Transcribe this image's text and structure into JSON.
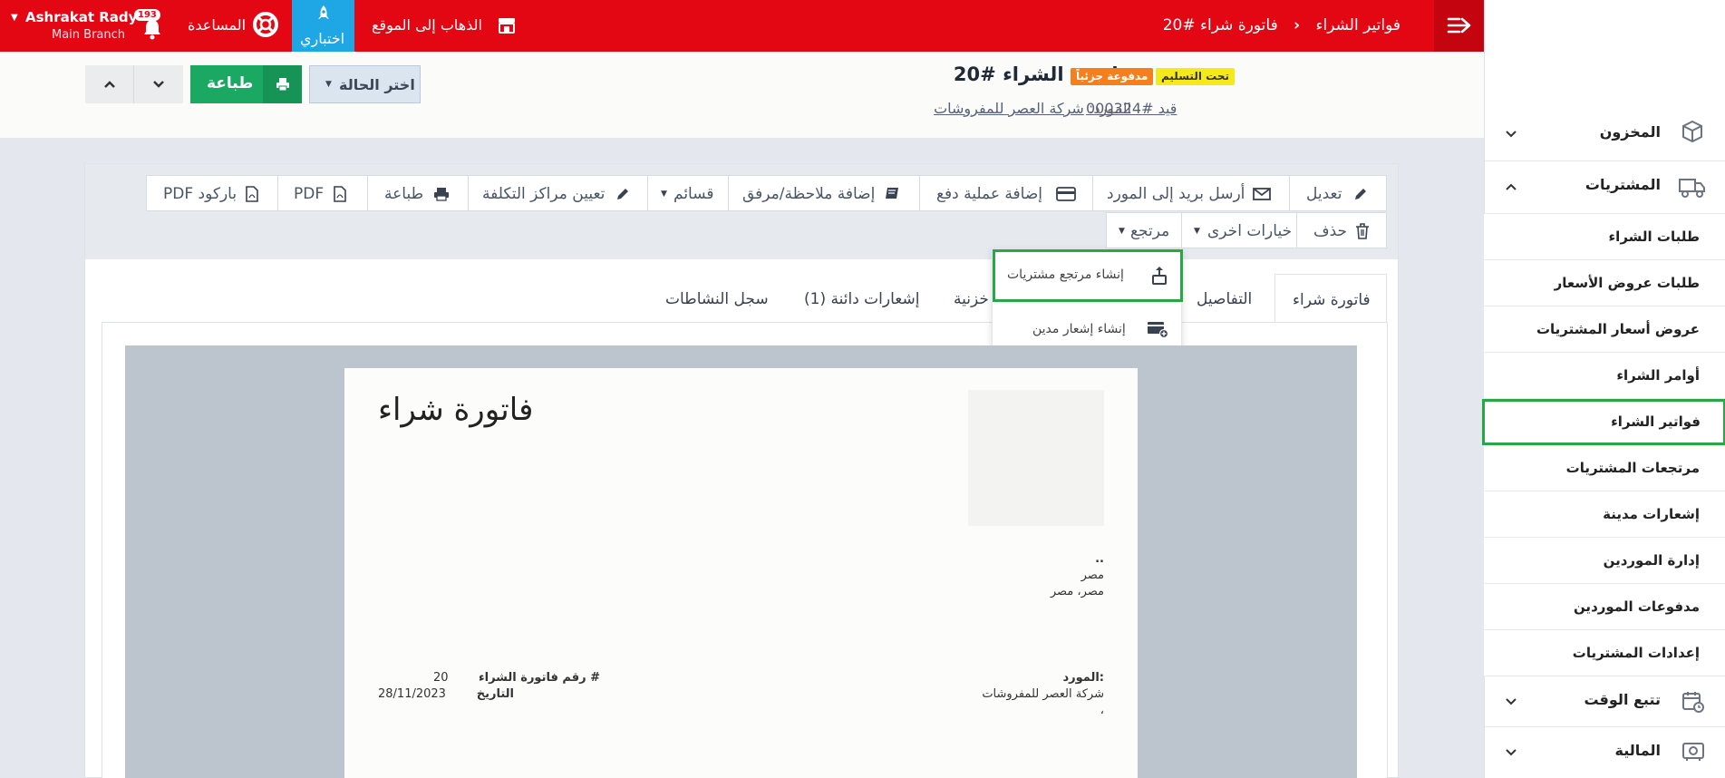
{
  "topbar": {
    "breadcrumb_parent": "فواتير الشراء",
    "breadcrumb_current": "فاتورة شراء #20",
    "goto_site": "الذهاب إلى الموقع",
    "trial": "اختباري",
    "help": "المساعدة",
    "notification_count": "193",
    "user_name": "Ashrakat Rady",
    "branch": "Main Branch"
  },
  "header": {
    "title": "فاتورة الشراء #20",
    "badge_delivery": "تحت التسليم",
    "badge_payment": "مدفوعة جزئياً",
    "supplier_label": "المورد:",
    "supplier_name": "شركة العصر للمفروشات",
    "journal_link": "قيد #000324",
    "status_select": "اختر الحالة",
    "print_button": "طباعة"
  },
  "toolbar": {
    "row1": [
      "تعديل",
      "أرسل بريد إلى المورد",
      "إضافة عملية دفع",
      "إضافة ملاحظة/مرفق",
      "قسائم",
      "تعيين مراكز التكلفة",
      "طباعة",
      "PDF",
      "PDF باركود"
    ],
    "row2": [
      "حذف",
      "خيارات اخرى",
      "مرتجع"
    ]
  },
  "dropdown": {
    "items": [
      "إنشاء مرتجع مشتريات",
      "إنشاء إشعار مدين"
    ]
  },
  "tabs": [
    "فاتورة شراء",
    "التفاصيل",
    "خزنية",
    "إشعارات دائنة (1)",
    "سجل النشاطات"
  ],
  "invoice": {
    "title": "فاتورة شراء",
    "address_dots": "..",
    "address_line1": "مصر",
    "address_line2": "مصر، مصر",
    "supplier_label": "المورد:",
    "supplier_name": "شركة العصر للمفروشات",
    "supplier_extra": "،",
    "number_label": "رقم فاتورة الشراء #",
    "number_value": "20",
    "date_label": "التاريخ",
    "date_value": "28/11/2023"
  },
  "sidebar": {
    "inventory": "المخزون",
    "purchases": "المشتريات",
    "sub_items": [
      "طلبات الشراء",
      "طلبات عروض الأسعار",
      "عروض أسعار المشتريات",
      "أوامر الشراء",
      "فواتير الشراء",
      "مرتجعات المشتريات",
      "إشعارات مدينة",
      "إدارة الموردين",
      "مدفوعات الموردين",
      "إعدادات المشتريات"
    ],
    "time_tracking": "تتبع الوقت",
    "finance": "المالية"
  },
  "colors": {
    "topbar": "#e30613",
    "trial_bg": "#1ea7e4",
    "print_green": "#1ba862",
    "highlight_green": "#27a844",
    "badge_yellow": "#f4ea1a",
    "badge_orange": "#f47f1f"
  }
}
